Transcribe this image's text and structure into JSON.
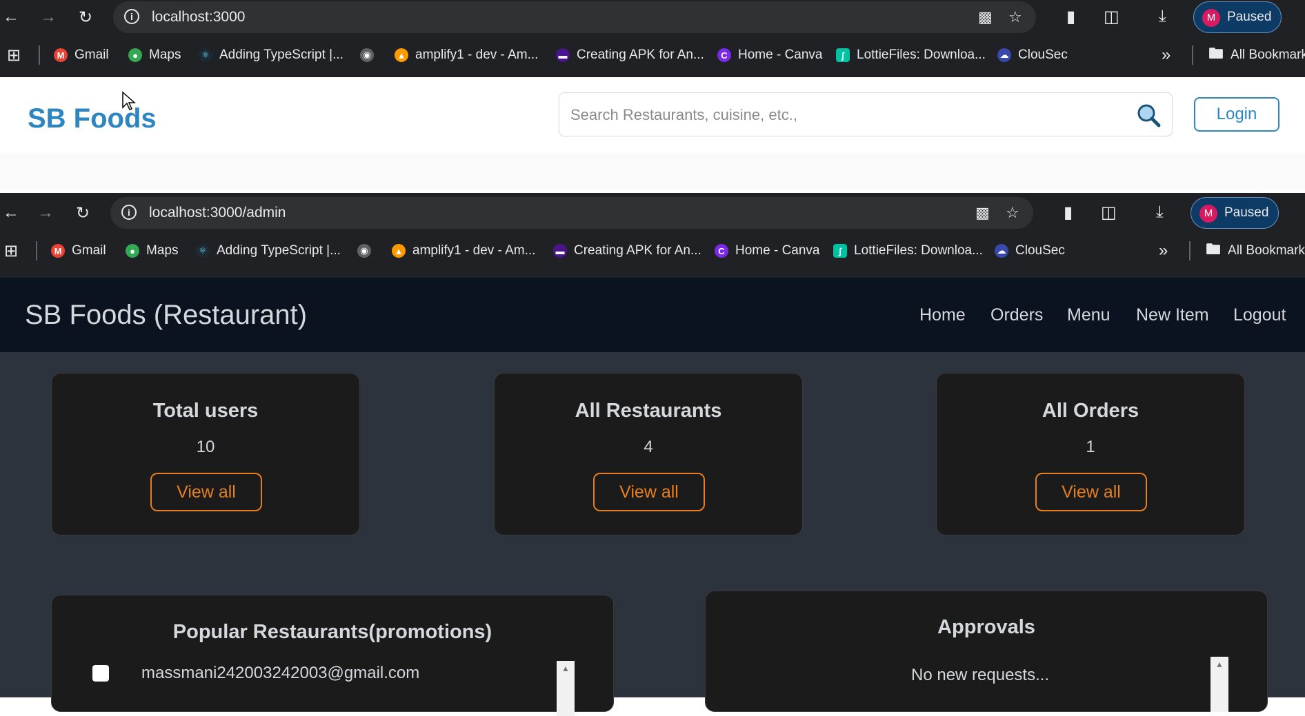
{
  "window1": {
    "url": "localhost:3000",
    "profile": {
      "initial": "M",
      "status": "Paused"
    },
    "bookmarks": [
      {
        "label": "Gmail",
        "icon": "gmail-icon"
      },
      {
        "label": "Maps",
        "icon": "maps-icon"
      },
      {
        "label": "Adding TypeScript |...",
        "icon": "react-icon"
      },
      {
        "label": "",
        "icon": "globe-icon"
      },
      {
        "label": "amplify1 - dev - Am...",
        "icon": "amplify-icon"
      },
      {
        "label": "Creating APK for An...",
        "icon": "apk-icon"
      },
      {
        "label": "Home - Canva",
        "icon": "canva-icon"
      },
      {
        "label": "LottieFiles: Downloa...",
        "icon": "lottie-icon"
      },
      {
        "label": "ClouSec",
        "icon": "clousec-icon"
      }
    ],
    "more": "»",
    "all_bookmarks": "All Bookmarks"
  },
  "sbfoods": {
    "logo": "SB Foods",
    "search_placeholder": "Search Restaurants, cuisine, etc.,",
    "login": "Login"
  },
  "window2": {
    "url": "localhost:3000/admin",
    "profile": {
      "initial": "M",
      "status": "Paused"
    },
    "bookmarks": [
      {
        "label": "Gmail",
        "icon": "gmail-icon"
      },
      {
        "label": "Maps",
        "icon": "maps-icon"
      },
      {
        "label": "Adding TypeScript |...",
        "icon": "react-icon"
      },
      {
        "label": "",
        "icon": "globe-icon"
      },
      {
        "label": "amplify1 - dev - Am...",
        "icon": "amplify-icon"
      },
      {
        "label": "Creating APK for An...",
        "icon": "apk-icon"
      },
      {
        "label": "Home - Canva",
        "icon": "canva-icon"
      },
      {
        "label": "LottieFiles: Downloa...",
        "icon": "lottie-icon"
      },
      {
        "label": "ClouSec",
        "icon": "clousec-icon"
      }
    ],
    "more": "»",
    "all_bookmarks": "All Bookmarks"
  },
  "admin": {
    "title": "SB Foods (Restaurant)",
    "nav": [
      "Home",
      "Orders",
      "Menu",
      "New Item",
      "Logout"
    ],
    "cards": [
      {
        "title": "Total users",
        "value": "10",
        "button": "View all"
      },
      {
        "title": "All Restaurants",
        "value": "4",
        "button": "View all"
      },
      {
        "title": "All Orders",
        "value": "1",
        "button": "View all"
      }
    ],
    "popular": {
      "title": "Popular Restaurants(promotions)",
      "items": [
        {
          "email": "massmani242003242003@gmail.com",
          "checked": false
        }
      ]
    },
    "approvals": {
      "title": "Approvals",
      "empty": "No new requests..."
    }
  },
  "colors": {
    "brand_blue": "#2e86c1",
    "accent_orange": "#e67e22",
    "admin_nav_bg": "#0b1320",
    "admin_body_bg": "#2c333d",
    "card_bg": "#1b1b1b"
  }
}
